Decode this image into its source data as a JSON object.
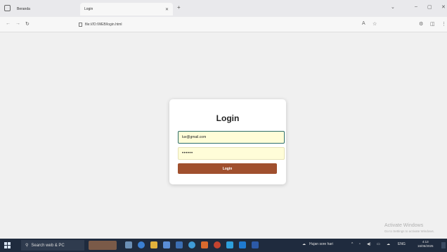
{
  "browser": {
    "tabs": [
      {
        "label": "Beranda",
        "active": false
      },
      {
        "label": "Login",
        "active": true
      }
    ],
    "url": "file:///D:/WEB/login.html"
  },
  "login": {
    "title": "Login",
    "email_value": "luv@gmail.com",
    "password_value": "••••••",
    "button_label": "Login"
  },
  "watermark": {
    "line1": "Activate Windows",
    "line2": "Go to Settings to activate Windows."
  },
  "taskbar": {
    "search_placeholder": "Search web & PC",
    "weather": "Hujan sore hari",
    "language": "ENG",
    "time": "4:13",
    "date": "16/06/2025"
  }
}
